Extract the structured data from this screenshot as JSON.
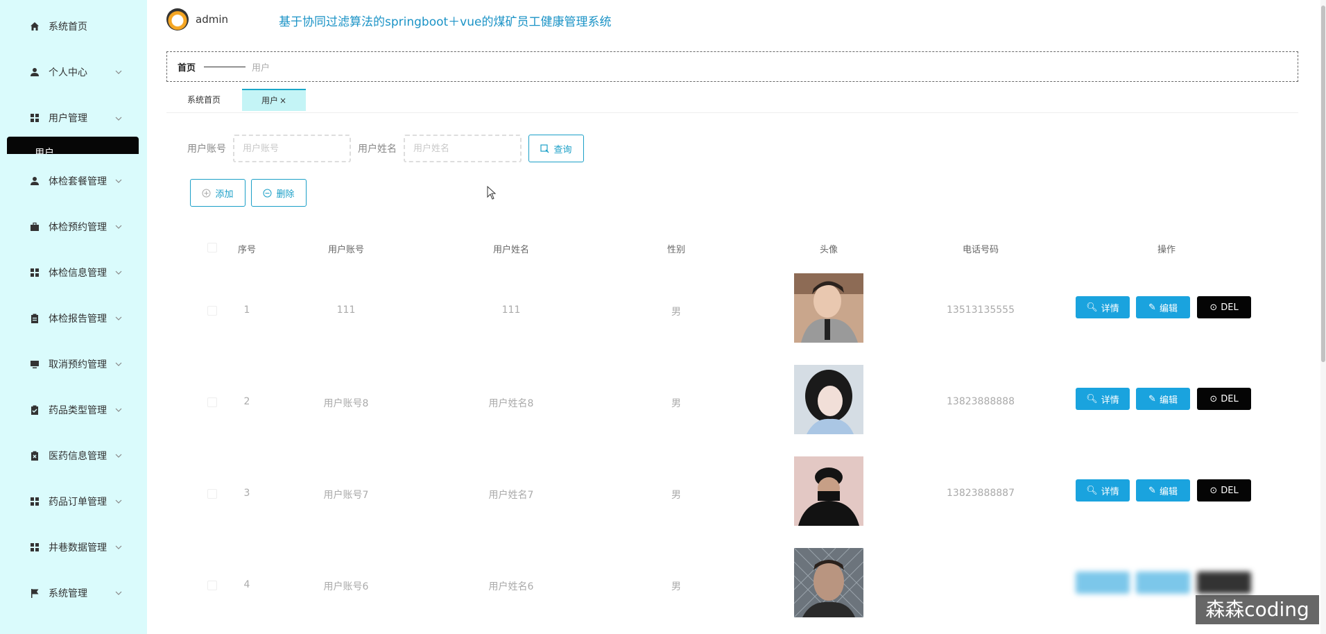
{
  "header": {
    "username": "admin",
    "system_title": "基于协同过滤算法的springboot＋vue的煤矿员工健康管理系统"
  },
  "sidebar": {
    "items": [
      {
        "label": "系统首页",
        "icon": "home-icon"
      },
      {
        "label": "个人中心",
        "icon": "user-icon"
      },
      {
        "label": "用户管理",
        "icon": "grid-icon"
      },
      {
        "label": "体检套餐管理",
        "icon": "user-icon"
      },
      {
        "label": "体检预约管理",
        "icon": "briefcase-icon"
      },
      {
        "label": "体检信息管理",
        "icon": "grid-icon"
      },
      {
        "label": "体检报告管理",
        "icon": "clipboard-icon"
      },
      {
        "label": "取消预约管理",
        "icon": "monitor-icon"
      },
      {
        "label": "药品类型管理",
        "icon": "clipboard-check-icon"
      },
      {
        "label": "医药信息管理",
        "icon": "clipboard-x-icon"
      },
      {
        "label": "药品订单管理",
        "icon": "grid-icon"
      },
      {
        "label": "井巷数据管理",
        "icon": "grid-icon"
      },
      {
        "label": "系统管理",
        "icon": "flag-icon"
      }
    ],
    "active_sub_item": "用户"
  },
  "breadcrumb": {
    "home": "首页",
    "current": "用户"
  },
  "tabs": [
    {
      "label": "系统首页"
    },
    {
      "label": "用户",
      "close": "×"
    }
  ],
  "search": {
    "account_label": "用户账号",
    "account_placeholder": "用户账号",
    "name_label": "用户姓名",
    "name_placeholder": "用户姓名",
    "query_button": "查询"
  },
  "toolbar": {
    "add_button": "添加",
    "delete_button": "删除"
  },
  "table": {
    "columns": [
      "序号",
      "用户账号",
      "用户姓名",
      "性别",
      "头像",
      "电话号码",
      "操作"
    ],
    "rows": [
      {
        "index": "1",
        "account": "111",
        "name": "111",
        "gender": "男",
        "phone": "13513135555"
      },
      {
        "index": "2",
        "account": "用户账号8",
        "name": "用户姓名8",
        "gender": "男",
        "phone": "13823888888"
      },
      {
        "index": "3",
        "account": "用户账号7",
        "name": "用户姓名7",
        "gender": "男",
        "phone": "13823888887"
      },
      {
        "index": "4",
        "account": "用户账号6",
        "name": "用户姓名6",
        "gender": "男",
        "phone": ""
      }
    ],
    "actions": {
      "detail": "详情",
      "edit": "编辑",
      "delete": "DEL"
    }
  },
  "watermark": "森森coding",
  "colors": {
    "sidebar_bg": "#dafbfc",
    "accent": "#1aa3de",
    "title": "#1b93c6",
    "active_tab": "#c4f4f6"
  }
}
